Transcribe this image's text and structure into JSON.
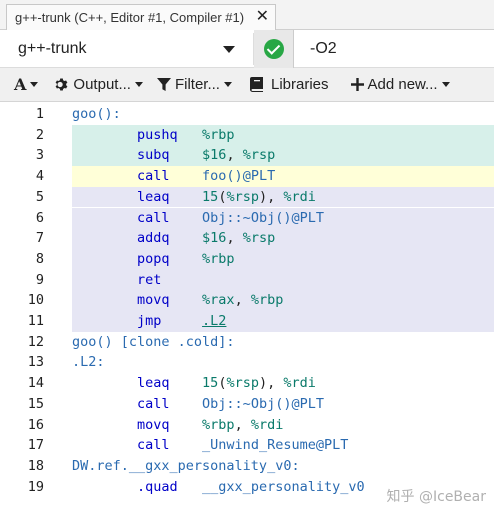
{
  "tab": {
    "title": "g++-trunk (C++, Editor #1, Compiler #1)",
    "close": "✕"
  },
  "compiler": {
    "name": "g++-trunk",
    "options": "-O2"
  },
  "toolbar": {
    "font_label": "A",
    "output_label": "Output...",
    "filter_label": "Filter...",
    "libraries_label": "Libraries",
    "add_new_label": "Add new..."
  },
  "colors": {
    "highlight_teal": "#d7f0ea",
    "highlight_yellow": "#ffffd8",
    "highlight_lavender": "#e6e6f4",
    "ok_green": "#28a745"
  },
  "lines": [
    {
      "num": "1",
      "hl": "",
      "tokens": [
        [
          "goo():",
          "label"
        ]
      ]
    },
    {
      "num": "2",
      "hl": "teal",
      "tokens": [
        [
          "        pushq   ",
          "instr"
        ],
        [
          "%rbp",
          "reg"
        ]
      ]
    },
    {
      "num": "3",
      "hl": "teal",
      "tokens": [
        [
          "        subq    ",
          "instr"
        ],
        [
          "$16",
          "num"
        ],
        [
          ", ",
          "sym"
        ],
        [
          "%rsp",
          "reg"
        ]
      ]
    },
    {
      "num": "4",
      "hl": "yellow",
      "tokens": [
        [
          "        call    ",
          "instr"
        ],
        [
          "foo()",
          "label"
        ],
        [
          "@PLT",
          "label"
        ]
      ]
    },
    {
      "num": "5",
      "hl": "lavender",
      "tokens": [
        [
          "        leaq    ",
          "instr"
        ],
        [
          "15",
          "num"
        ],
        [
          "(",
          "sym"
        ],
        [
          "%rsp",
          "reg"
        ],
        [
          "), ",
          "sym"
        ],
        [
          "%rdi",
          "reg"
        ]
      ]
    },
    {
      "num": "6",
      "hl": "lavender",
      "tokens": [
        [
          "        call    ",
          "instr"
        ],
        [
          "Obj::~Obj()",
          "label"
        ],
        [
          "@PLT",
          "label"
        ]
      ]
    },
    {
      "num": "7",
      "hl": "lavender",
      "tokens": [
        [
          "        addq    ",
          "instr"
        ],
        [
          "$16",
          "num"
        ],
        [
          ", ",
          "sym"
        ],
        [
          "%rsp",
          "reg"
        ]
      ]
    },
    {
      "num": "8",
      "hl": "lavender",
      "tokens": [
        [
          "        popq    ",
          "instr"
        ],
        [
          "%rbp",
          "reg"
        ]
      ]
    },
    {
      "num": "9",
      "hl": "lavender",
      "tokens": [
        [
          "        ret",
          "instr"
        ]
      ]
    },
    {
      "num": "10",
      "hl": "lavender",
      "tokens": [
        [
          "        movq    ",
          "instr"
        ],
        [
          "%rax",
          "reg"
        ],
        [
          ", ",
          "sym"
        ],
        [
          "%rbp",
          "reg"
        ]
      ]
    },
    {
      "num": "11",
      "hl": "lavender",
      "tokens": [
        [
          "        jmp     ",
          "instr"
        ],
        [
          ".L2",
          "link"
        ]
      ]
    },
    {
      "num": "12",
      "hl": "",
      "tokens": [
        [
          "goo() [clone .cold]:",
          "label"
        ]
      ]
    },
    {
      "num": "13",
      "hl": "",
      "tokens": [
        [
          ".L2:",
          "label"
        ]
      ]
    },
    {
      "num": "14",
      "hl": "",
      "tokens": [
        [
          "        leaq    ",
          "instr"
        ],
        [
          "15",
          "num"
        ],
        [
          "(",
          "sym"
        ],
        [
          "%rsp",
          "reg"
        ],
        [
          "), ",
          "sym"
        ],
        [
          "%rdi",
          "reg"
        ]
      ]
    },
    {
      "num": "15",
      "hl": "",
      "tokens": [
        [
          "        call    ",
          "instr"
        ],
        [
          "Obj::~Obj()",
          "label"
        ],
        [
          "@PLT",
          "label"
        ]
      ]
    },
    {
      "num": "16",
      "hl": "",
      "tokens": [
        [
          "        movq    ",
          "instr"
        ],
        [
          "%rbp",
          "reg"
        ],
        [
          ", ",
          "sym"
        ],
        [
          "%rdi",
          "reg"
        ]
      ]
    },
    {
      "num": "17",
      "hl": "",
      "tokens": [
        [
          "        call    ",
          "instr"
        ],
        [
          "_Unwind_Resume@PLT",
          "label"
        ]
      ]
    },
    {
      "num": "18",
      "hl": "",
      "tokens": [
        [
          "DW.ref.__gxx_personality_v0:",
          "label"
        ]
      ]
    },
    {
      "num": "19",
      "hl": "",
      "tokens": [
        [
          "        .quad   ",
          "instr"
        ],
        [
          "__gxx_personality_v0",
          "label"
        ]
      ]
    }
  ],
  "watermark": "知乎 @IceBear"
}
